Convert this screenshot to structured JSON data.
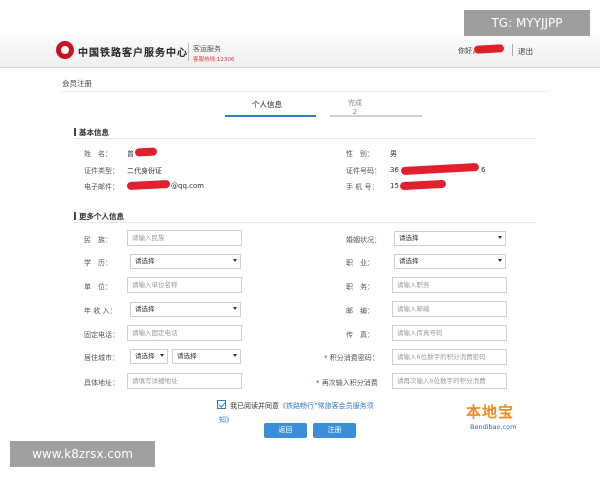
{
  "watermark_top": "TG: MYYJJPP",
  "watermark_bottom": "www.k8zrsx.com",
  "header": {
    "brand": "中国铁路客户服务中心",
    "sub": "客运服务",
    "hotline": "客服热线:12306",
    "greeting": "你好，",
    "logout": "退出"
  },
  "page_title": "会员注册",
  "steps": [
    {
      "label": "个人信息"
    },
    {
      "label": "完成",
      "num": "2"
    }
  ],
  "basic": {
    "title": "基本信息",
    "name_label": "姓　名：",
    "name_value": "曾",
    "gender_label": "性　别：",
    "gender_value": "男",
    "idtype_label": "证件类型：",
    "idtype_value": "二代身份证",
    "idno_label": "证件号码：",
    "idno_value_prefix": "36",
    "idno_value_suffix": "6",
    "email_label": "电子邮件：",
    "email_value_suffix": "@qq.com",
    "phone_label": "手 机 号：",
    "phone_value_prefix": "15"
  },
  "more": {
    "title": "更多个人信息",
    "left": [
      {
        "label": "民　族：",
        "placeholder": "请输入民族",
        "kind": "input"
      },
      {
        "label": "学　历：",
        "value": "请选择",
        "kind": "select"
      },
      {
        "label": "单　位：",
        "placeholder": "请输入单位名称",
        "kind": "input"
      },
      {
        "label": "年 收 入：",
        "value": "请选择",
        "kind": "select"
      },
      {
        "label": "固定电话：",
        "placeholder": "请输入固定电话",
        "kind": "input"
      },
      {
        "label": "居住城市：",
        "value": "请选择",
        "value2": "请选择",
        "kind": "select2"
      },
      {
        "label": "具体地址：",
        "placeholder": "请填写详细地址",
        "kind": "input"
      }
    ],
    "right": [
      {
        "label": "婚姻状况：",
        "value": "请选择",
        "kind": "select"
      },
      {
        "label": "职　业：",
        "value": "请选择",
        "kind": "select"
      },
      {
        "label": "职　务：",
        "placeholder": "请输入职务",
        "kind": "input"
      },
      {
        "label": "邮　编：",
        "placeholder": "请输入邮编",
        "kind": "input"
      },
      {
        "label": "传　真：",
        "placeholder": "请输入传真号码",
        "kind": "input"
      },
      {
        "label": "积分消费密码：",
        "placeholder": "请输入6位数字的积分消费密码",
        "kind": "input",
        "required": true
      },
      {
        "label": "再次输入积分消费",
        "placeholder": "请再次输入6位数字的积分消费",
        "kind": "input",
        "required": true
      }
    ]
  },
  "agreement": {
    "text": "我已阅读并同意",
    "link": "《铁路畅行”常旅客会员服务须",
    "link2": "知》"
  },
  "buttons": {
    "back": "返回",
    "register": "注册"
  },
  "bendibao": {
    "main": "本地宝",
    "sub": "Bendibao.com"
  }
}
